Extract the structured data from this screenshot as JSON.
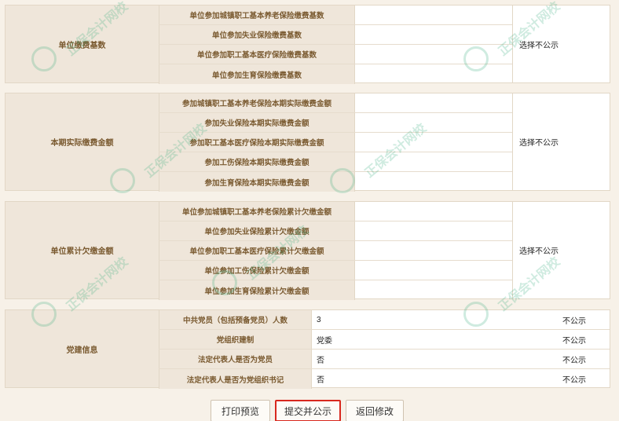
{
  "section1": {
    "label": "单位缴费基数",
    "rows": [
      "单位参加城镇职工基本养老保险缴费基数",
      "单位参加失业保险缴费基数",
      "单位参加职工基本医疗保险缴费基数",
      "单位参加生育保险缴费基数"
    ],
    "right": "选择不公示"
  },
  "section2": {
    "label": "本期实际缴费金额",
    "rows": [
      "参加城镇职工基本养老保险本期实际缴费金额",
      "参加失业保险本期实际缴费金额",
      "参加职工基本医疗保险本期实际缴费金额",
      "参加工伤保险本期实际缴费金额",
      "参加生育保险本期实际缴费金额"
    ],
    "right": "选择不公示"
  },
  "section3": {
    "label": "单位累计欠缴金额",
    "rows": [
      "单位参加城镇职工基本养老保险累计欠缴金额",
      "单位参加失业保险累计欠缴金额",
      "单位参加职工基本医疗保险累计欠缴金额",
      "单位参加工伤保险累计欠缴金额",
      "单位参加生育保险累计欠缴金额"
    ],
    "right": "选择不公示"
  },
  "party": {
    "label": "党建信息",
    "rows": [
      {
        "label": "中共党员（包括预备党员）人数",
        "value": "3",
        "pub": "不公示"
      },
      {
        "label": "党组织建制",
        "value": "党委",
        "pub": "不公示"
      },
      {
        "label": "法定代表人是否为党员",
        "value": "否",
        "pub": "不公示"
      },
      {
        "label": "法定代表人是否为党组织书记",
        "value": "否",
        "pub": "不公示"
      }
    ]
  },
  "buttons": {
    "print": "打印预览",
    "submit": "提交并公示",
    "back": "返回修改"
  },
  "watermark": {
    "text": "正保会计网校",
    "url": "www.chinaacc.com"
  },
  "colors": {
    "accent": "#d8281e",
    "label_bg": "#efe6da",
    "label_text": "#7a5a30",
    "watermark": "#2aa876"
  }
}
